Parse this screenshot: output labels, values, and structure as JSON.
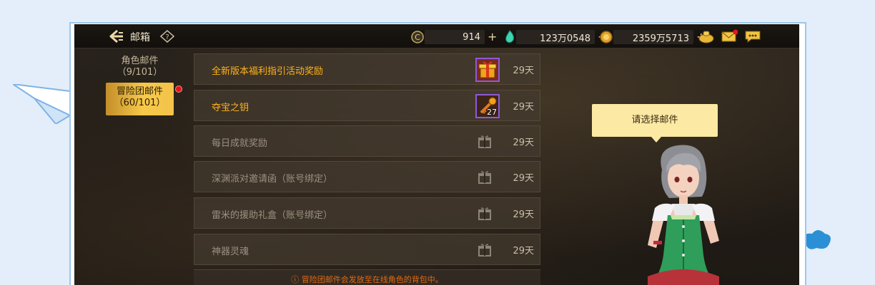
{
  "header": {
    "title": "邮箱",
    "help_icon": "question-mark-diamond-icon"
  },
  "resources": [
    {
      "name": "coin",
      "icon": "c-coin-icon",
      "value": "914"
    },
    {
      "name": "gem",
      "icon": "green-gem-icon",
      "value": "123万0548"
    },
    {
      "name": "gold",
      "icon": "gold-coin-icon",
      "value": "2359万5713"
    }
  ],
  "top_icons": [
    "treasure-bag-icon",
    "mail-envelope-icon",
    "chat-bubble-icon"
  ],
  "tabs": [
    {
      "label": "角色邮件",
      "count": "（9/101）",
      "active": false
    },
    {
      "label": "冒险团邮件",
      "count": "（60/101）",
      "active": true
    }
  ],
  "mails": [
    {
      "title": "全新版本福利指引活动奖励",
      "days": "29天",
      "state": "unread",
      "attachment": "gift-box-item-icon",
      "count": ""
    },
    {
      "title": "夺宝之钥",
      "days": "29天",
      "state": "unread",
      "attachment": "key-item-icon",
      "count": "27"
    },
    {
      "title": "每日成就奖励",
      "days": "29天",
      "state": "read",
      "attachment": "gift-icon",
      "count": ""
    },
    {
      "title": "深渊派对邀请函（账号绑定）",
      "days": "29天",
      "state": "read",
      "attachment": "gift-icon",
      "count": ""
    },
    {
      "title": "雷米的援助礼盒（账号绑定）",
      "days": "29天",
      "state": "read",
      "attachment": "gift-icon",
      "count": ""
    },
    {
      "title": "神器灵魂",
      "days": "29天",
      "state": "read",
      "attachment": "gift-icon",
      "count": ""
    }
  ],
  "notice": "冒险团邮件会发放至在线角色的背包中。",
  "npc": {
    "bubble_text": "请选择邮件"
  },
  "colors": {
    "unread_title": "#ffb319",
    "read_title": "#9b9080",
    "active_tab": "#f7c94a",
    "bubble": "#fbe9a4"
  }
}
